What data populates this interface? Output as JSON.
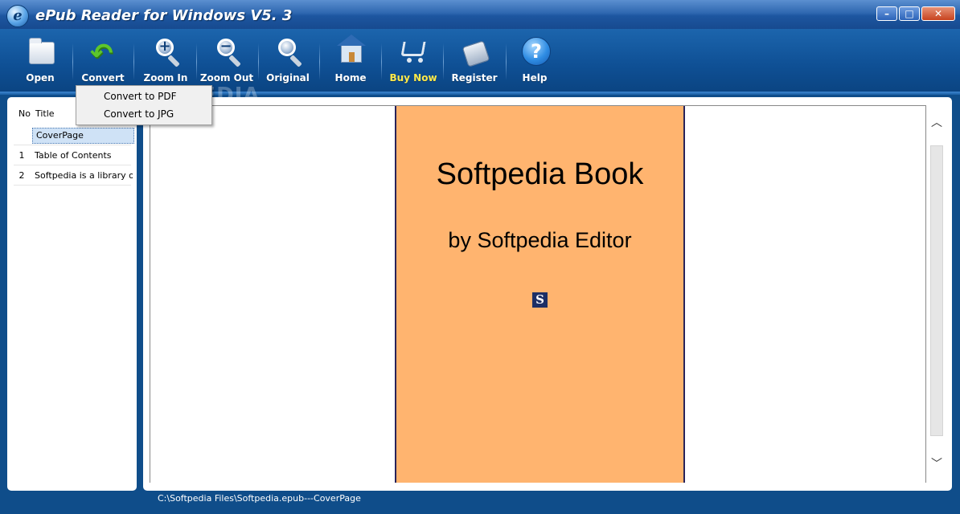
{
  "window": {
    "title": "ePub Reader for Windows V5. 3",
    "icon": "e"
  },
  "toolbar": {
    "open": "Open",
    "convert": "Convert",
    "zoom_in": "Zoom In",
    "zoom_out": "Zoom Out",
    "original": "Original",
    "home": "Home",
    "buy_now": "Buy Now",
    "register": "Register",
    "help": "Help"
  },
  "convert_menu": {
    "items": [
      "Convert to PDF",
      "Convert to JPG"
    ]
  },
  "watermark": "SOFTPEDIA",
  "toc": {
    "headers": {
      "no": "No",
      "title": "Title"
    },
    "rows": [
      {
        "no": "",
        "title": "CoverPage"
      },
      {
        "no": "1",
        "title": "Table of Contents"
      },
      {
        "no": "2",
        "title": "Softpedia is a library of c"
      }
    ]
  },
  "cover": {
    "title": "Softpedia Book",
    "author": "by Softpedia Editor",
    "logo": "S",
    "background": "#ffb46f"
  },
  "status": {
    "path": "C:\\Softpedia Files\\Softpedia.epub---CoverPage"
  },
  "colors": {
    "frame": "#0f4d8a",
    "buy_now": "#ffe94a",
    "selection": "#cfe2f6"
  }
}
